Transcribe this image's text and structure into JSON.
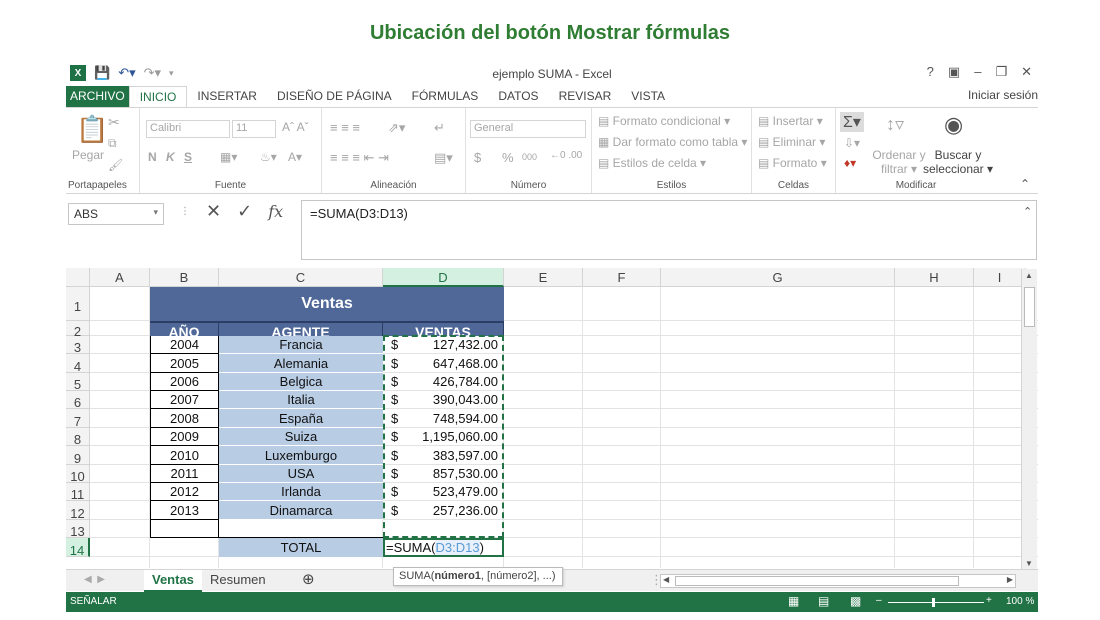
{
  "heading": "Ubicación del botón Mostrar fórmulas",
  "window": {
    "title": "ejemplo SUMA - Excel",
    "help": "?",
    "signin": "Iniciar sesión"
  },
  "tabs": [
    "ARCHIVO",
    "INICIO",
    "INSERTAR",
    "DISEÑO DE PÁGINA",
    "FÓRMULAS",
    "DATOS",
    "REVISAR",
    "VISTA"
  ],
  "ribbon": {
    "clipboard": {
      "paste": "Pegar",
      "label": "Portapapeles"
    },
    "font": {
      "name": "Calibri",
      "size": "11",
      "label": "Fuente",
      "bold": "N",
      "italic": "K",
      "underline": "S"
    },
    "alignment": {
      "label": "Alineación"
    },
    "number": {
      "format": "General",
      "label": "Número",
      "currency": "$",
      "percent": "%",
      "thousands": "000"
    },
    "styles": {
      "conditional": "Formato condicional",
      "table": "Dar formato como tabla",
      "cell": "Estilos de celda",
      "label": "Estilos"
    },
    "cells": {
      "insert": "Insertar",
      "delete": "Eliminar",
      "format": "Formato",
      "label": "Celdas"
    },
    "editing": {
      "sort1": "Ordenar y",
      "sort2": "filtrar",
      "find1": "Buscar y",
      "find2": "seleccionar",
      "label": "Modificar"
    }
  },
  "formula_bar": {
    "name_box": "ABS",
    "formula": "=SUMA(D3:D13)",
    "fx": "fx"
  },
  "columns": [
    "A",
    "B",
    "C",
    "D",
    "E",
    "F",
    "G",
    "H",
    "I"
  ],
  "rows": [
    "1",
    "2",
    "3",
    "4",
    "5",
    "6",
    "7",
    "8",
    "9",
    "10",
    "11",
    "12",
    "13",
    "14"
  ],
  "table": {
    "title": "Ventas",
    "headers": [
      "AÑO",
      "AGENTE",
      "VENTAS"
    ],
    "currency": "$",
    "data": [
      [
        "2004",
        "Francia",
        "127,432.00"
      ],
      [
        "2005",
        "Alemania",
        "647,468.00"
      ],
      [
        "2006",
        "Belgica",
        "426,784.00"
      ],
      [
        "2007",
        "Italia",
        "390,043.00"
      ],
      [
        "2008",
        "España",
        "748,594.00"
      ],
      [
        "2009",
        "Suiza",
        "1,195,060.00"
      ],
      [
        "2010",
        "Luxemburgo",
        "383,597.00"
      ],
      [
        "2011",
        "USA",
        "857,530.00"
      ],
      [
        "2012",
        "Irlanda",
        "523,479.00"
      ],
      [
        "2013",
        "Dinamarca",
        "257,236.00"
      ]
    ],
    "total_label": "TOTAL",
    "total_formula_prefix": "=SUMA(",
    "total_formula_ref": "D3:D13",
    "total_formula_suffix": ")"
  },
  "tooltip": {
    "prefix": "SUMA(",
    "bold": "número1",
    "rest": ", [número2], ...)"
  },
  "sheets": [
    "Ventas",
    "Resumen"
  ],
  "status": {
    "mode": "SEÑALAR",
    "zoom": "100 %"
  },
  "colors": {
    "accent": "#217346",
    "header_fill": "#4f6897",
    "body_fill": "#b8cce4"
  }
}
